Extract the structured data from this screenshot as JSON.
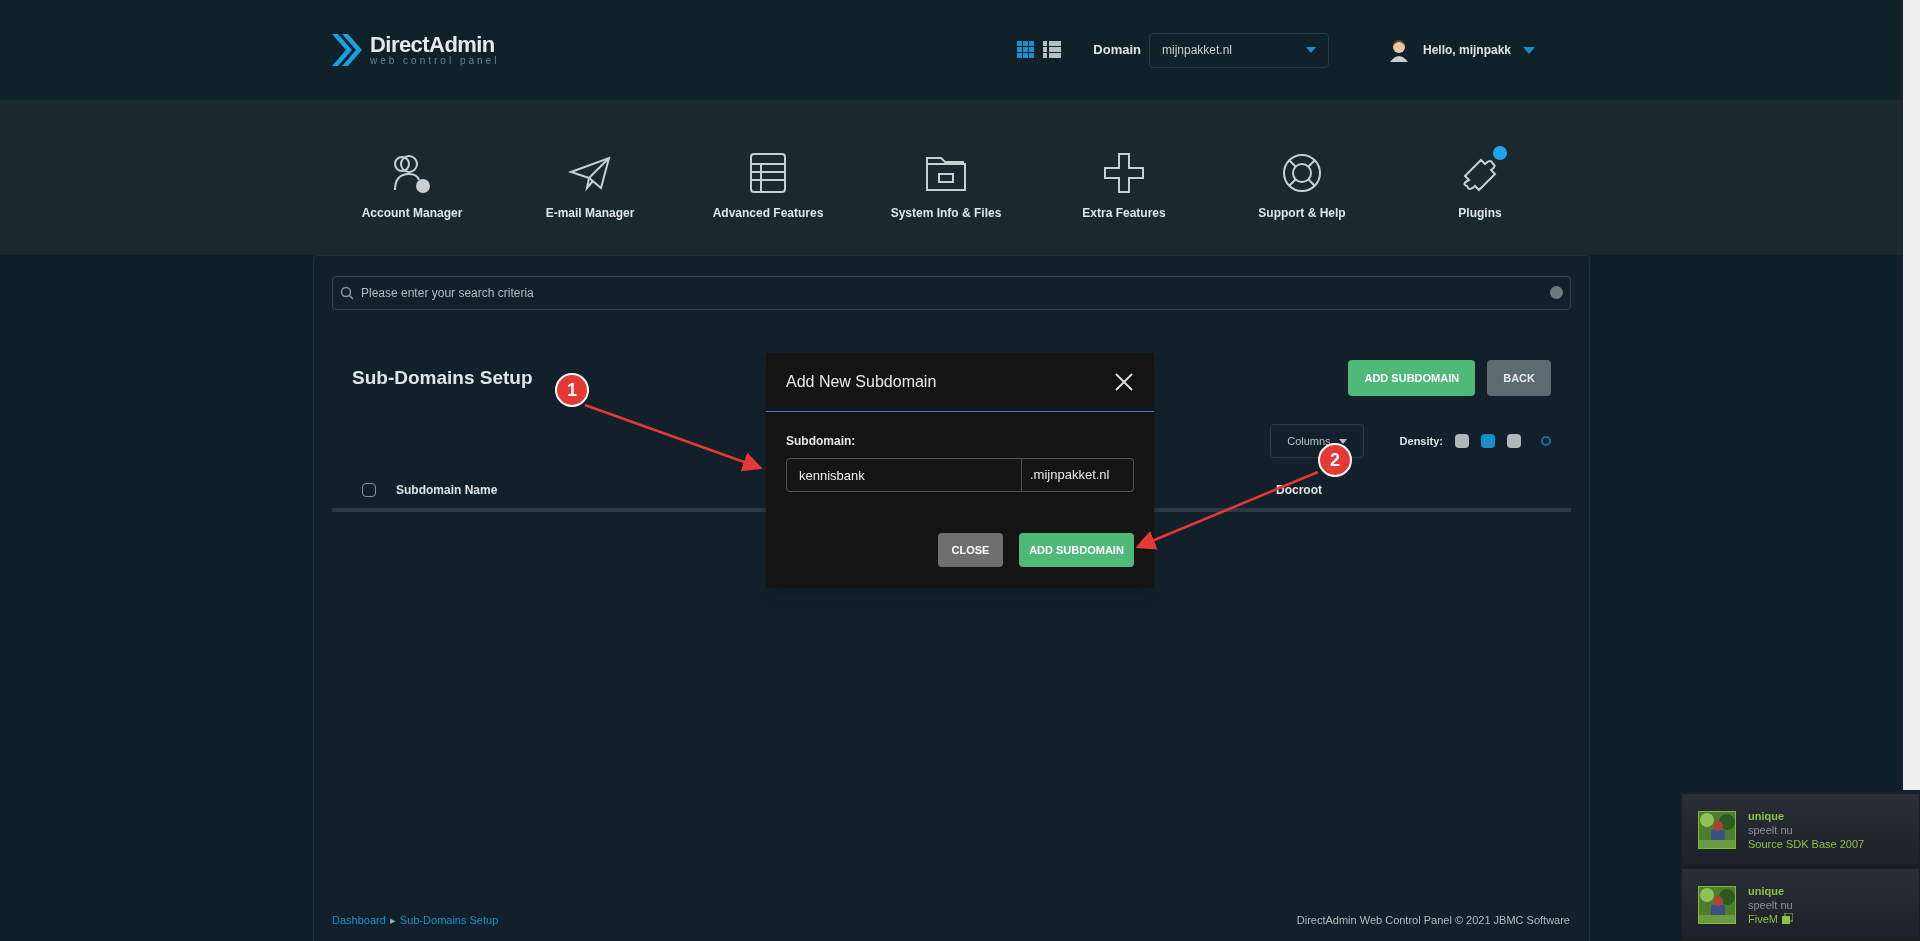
{
  "header": {
    "logo_title": "DirectAdmin",
    "logo_subtitle": "web control panel",
    "view_modes": [
      {
        "kind": "grid",
        "selected": true
      },
      {
        "kind": "list",
        "selected": false
      }
    ],
    "domain_label": "Domain",
    "domain_value": "mijnpakket.nl",
    "greeting": "Hello, mijnpakk"
  },
  "nav": [
    {
      "label": "Account Manager",
      "kind": "users",
      "badge": false
    },
    {
      "label": "E-mail Manager",
      "kind": "plane",
      "badge": false
    },
    {
      "label": "Advanced Features",
      "kind": "table",
      "badge": false
    },
    {
      "label": "System Info & Files",
      "kind": "folder",
      "badge": false
    },
    {
      "label": "Extra Features",
      "kind": "plus",
      "badge": false
    },
    {
      "label": "Support & Help",
      "kind": "lifebuoy",
      "badge": false
    },
    {
      "label": "Plugins",
      "kind": "puzzle",
      "badge": true
    }
  ],
  "search": {
    "placeholder": "Please enter your search criteria"
  },
  "page": {
    "title": "Sub-Domains Setup",
    "buttons": [
      {
        "label": "ADD SUBDOMAIN",
        "kind": "primary"
      },
      {
        "label": "BACK",
        "kind": "secondary"
      }
    ],
    "columns_button": "Columns",
    "density_label": "Density:",
    "density": [
      {
        "selected": false
      },
      {
        "selected": true
      },
      {
        "selected": false
      }
    ],
    "table": {
      "select_all_checked": false,
      "columns": [
        "Subdomain Name",
        "Docroot"
      ]
    }
  },
  "footer": {
    "breadcrumb": [
      "Dashboard",
      "Sub-Domains Setup"
    ],
    "breadcrumb_separator": "▸",
    "copyright": "DirectAdmin Web Control Panel © 2021 JBMC Software"
  },
  "dialog": {
    "title": "Add New Subdomain",
    "field_label": "Subdomain:",
    "value": "kennisbank",
    "suffix": ".mijnpakket.nl",
    "buttons": [
      {
        "label": "CLOSE",
        "kind": "secondary"
      },
      {
        "label": "ADD SUBDOMAIN",
        "kind": "primary"
      }
    ]
  },
  "annotations": [
    {
      "label": "1"
    },
    {
      "label": "2"
    }
  ],
  "notifications": [
    {
      "user": "unique",
      "status": "speelt nu",
      "game": "Source SDK Base 2007",
      "game_icon": false
    },
    {
      "user": "unique",
      "status": "speelt nu",
      "game": "FiveM",
      "game_icon": true
    }
  ]
}
